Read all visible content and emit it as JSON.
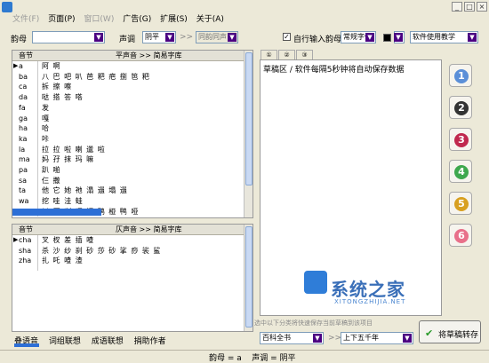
{
  "menu": [
    "文件(F)",
    "页面(P)",
    "窗口(W)",
    "广告(G)",
    "扩展(S)",
    "关于(A)"
  ],
  "toolbar": {
    "yunmu_label": "韵母",
    "shengdiao_label": "声调",
    "shengdiao_value": "阴平",
    "arrow": ">>",
    "tongyun_value": "同韵同声",
    "auto_label": "自行输入韵母",
    "font_value": "常规字体",
    "rhyme_value": "软件使用教学"
  },
  "pingtable": {
    "col1": "音节",
    "col2": "平声音 >> 简易字库",
    "rows": [
      {
        "k": "a",
        "v": "阿 啊"
      },
      {
        "k": "ba",
        "v": "八 巴 吧 叭 芭 粑 疤 捌 笆 粑"
      },
      {
        "k": "ca",
        "v": "拆 擦 嚓"
      },
      {
        "k": "da",
        "v": "哒 搭 答 嗒"
      },
      {
        "k": "fa",
        "v": "发"
      },
      {
        "k": "ga",
        "v": "嘎"
      },
      {
        "k": "ha",
        "v": "哈"
      },
      {
        "k": "ka",
        "v": "咔"
      },
      {
        "k": "la",
        "v": "拉 拉 啦 喇 邋 啦"
      },
      {
        "k": "ma",
        "v": "妈 孖 抹 玛 嘛"
      },
      {
        "k": "pa",
        "v": "趴 啪"
      },
      {
        "k": "sa",
        "v": "仨 撒"
      },
      {
        "k": "ta",
        "v": "他 它 她 祂 溻 遢 塌 遢"
      },
      {
        "k": "wa",
        "v": "挖 哇 洼 蛙"
      },
      {
        "k": "ya",
        "v": "丫 压 吖 呀 押 鸦 桠 鸭 哑"
      }
    ]
  },
  "zetable": {
    "col1": "音节",
    "col2": "仄声音 >> 简易字库",
    "rows": [
      {
        "k": "cha",
        "v": "叉 杈 差 插 喳"
      },
      {
        "k": "sha",
        "v": "杀 沙 纱 刹 砂 莎 砂 挲 痧 裟 鲨"
      },
      {
        "k": "zha",
        "v": "扎 吒 喳 渣"
      }
    ]
  },
  "draft": {
    "tabs": [
      "①",
      "②",
      "③"
    ],
    "text": "草稿区 / 软件每隔5秒钟将自动保存数据",
    "hint": "选中以下分类将快速保存当前草稿到该项目"
  },
  "side_numbers": [
    "1",
    "2",
    "3",
    "4",
    "5",
    "6"
  ],
  "bottom": {
    "tabs": [
      "叠语音",
      "词组联想",
      "成语联想",
      "捐助作者"
    ],
    "category_value": "百科全书",
    "arrow": ">>",
    "sub_value": "上下五千年",
    "save_button": "将草稿转存"
  },
  "status": {
    "text": "韵母 = a    声调 = 阴平"
  },
  "watermark": {
    "cn": "系统之家",
    "en": "XITONGZHIJIA.NET"
  },
  "colors": {
    "num": [
      "#5b8fd8",
      "#333333",
      "#c0284e",
      "#3ea84e",
      "#d8a020",
      "#e8708a"
    ]
  }
}
